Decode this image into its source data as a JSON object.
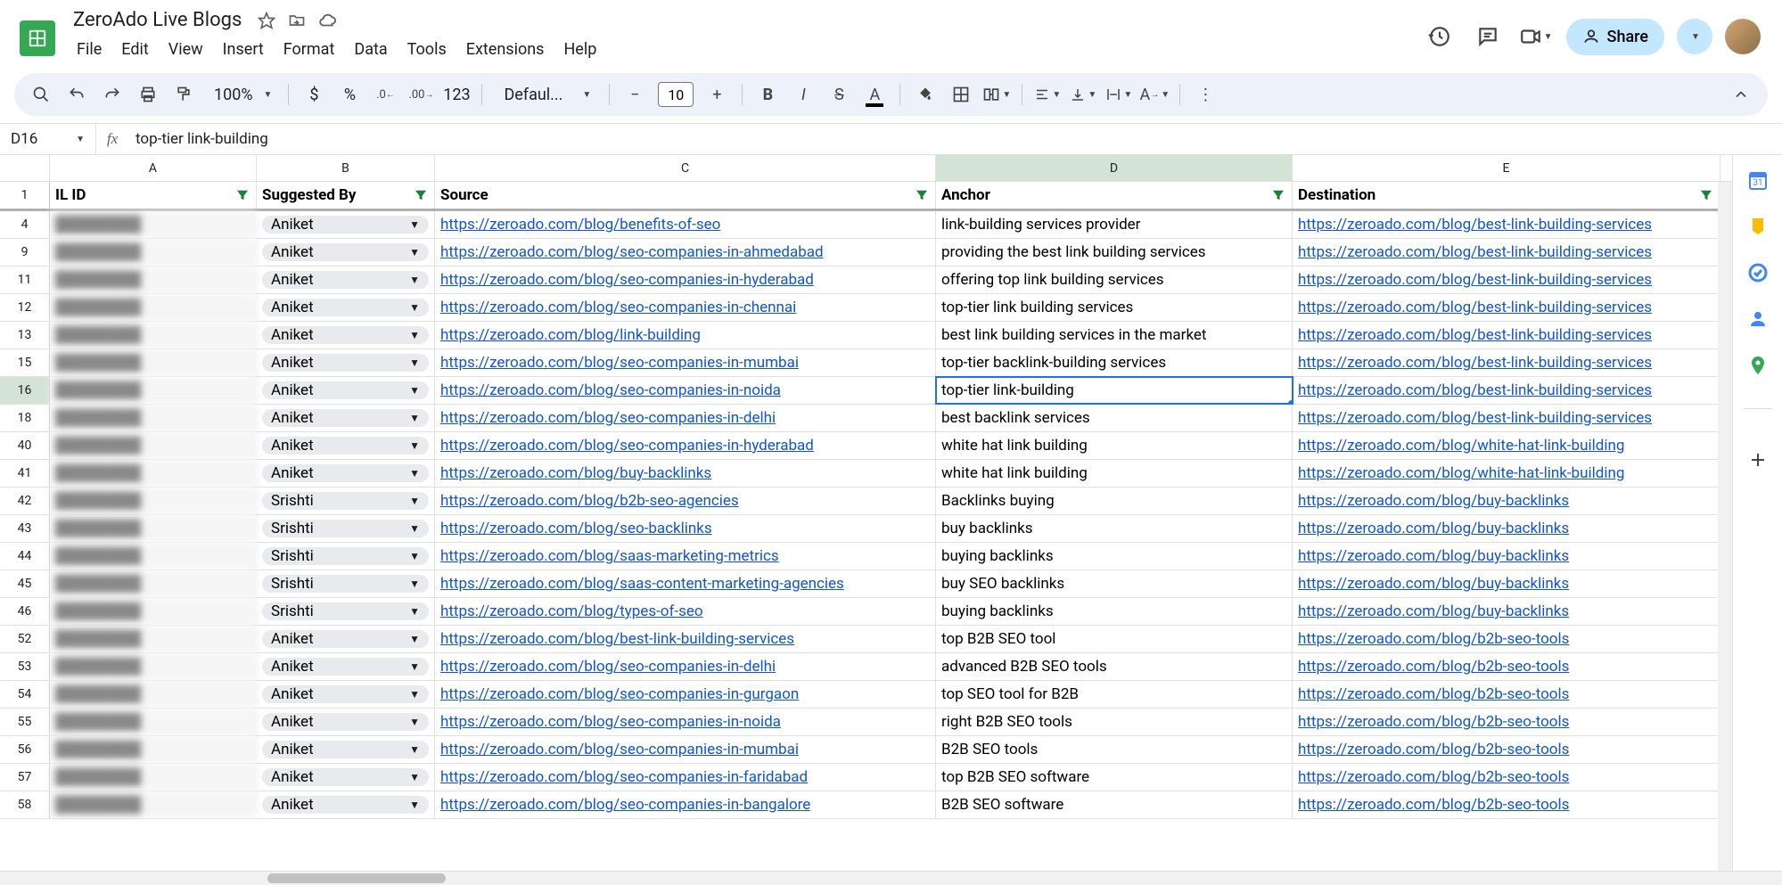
{
  "doc_title": "ZeroAdo Live Blogs",
  "menu": {
    "file": "File",
    "edit": "Edit",
    "view": "View",
    "insert": "Insert",
    "format": "Format",
    "data": "Data",
    "tools": "Tools",
    "extensions": "Extensions",
    "help": "Help"
  },
  "share_label": "Share",
  "toolbar": {
    "zoom": "100%",
    "font": "Defaul...",
    "size": "10",
    "currency": "$",
    "percent": "%",
    "dec_dec": ".0",
    "dec_inc": ".00",
    "num_fmt": "123"
  },
  "name_box": "D16",
  "formula": "top-tier link-building",
  "columns": [
    "A",
    "B",
    "C",
    "D",
    "E"
  ],
  "selected_col": "D",
  "selected_row": "16",
  "headers": {
    "A": "IL ID",
    "B": "Suggested By",
    "C": "Source",
    "D": "Anchor",
    "E": "Destination"
  },
  "row_numbers": [
    "1",
    "4",
    "9",
    "11",
    "12",
    "13",
    "15",
    "16",
    "18",
    "40",
    "41",
    "42",
    "43",
    "44",
    "45",
    "46",
    "52",
    "53",
    "54",
    "55",
    "56",
    "57",
    "58"
  ],
  "rows": [
    {
      "b": "Aniket",
      "c": "https://zeroado.com/blog/benefits-of-seo",
      "d": "link-building services provider",
      "e": "https://zeroado.com/blog/best-link-building-services"
    },
    {
      "b": "Aniket",
      "c": "https://zeroado.com/blog/seo-companies-in-ahmedabad",
      "d": "providing the best link building services",
      "e": "https://zeroado.com/blog/best-link-building-services"
    },
    {
      "b": "Aniket",
      "c": "https://zeroado.com/blog/seo-companies-in-hyderabad",
      "d": "offering top link building services",
      "e": "https://zeroado.com/blog/best-link-building-services"
    },
    {
      "b": "Aniket",
      "c": "https://zeroado.com/blog/seo-companies-in-chennai",
      "d": "top-tier link building services",
      "e": "https://zeroado.com/blog/best-link-building-services"
    },
    {
      "b": "Aniket",
      "c": "https://zeroado.com/blog/link-building",
      "d": "best link building services in the market",
      "e": "https://zeroado.com/blog/best-link-building-services"
    },
    {
      "b": "Aniket",
      "c": "https://zeroado.com/blog/seo-companies-in-mumbai",
      "d": "top-tier backlink-building services",
      "e": "https://zeroado.com/blog/best-link-building-services"
    },
    {
      "b": "Aniket",
      "c": "https://zeroado.com/blog/seo-companies-in-noida",
      "d": "top-tier link-building",
      "e": "https://zeroado.com/blog/best-link-building-services"
    },
    {
      "b": "Aniket",
      "c": "https://zeroado.com/blog/seo-companies-in-delhi",
      "d": "best backlink services",
      "e": "https://zeroado.com/blog/best-link-building-services"
    },
    {
      "b": "Aniket",
      "c": "https://zeroado.com/blog/seo-companies-in-hyderabad",
      "d": "white hat link building",
      "e": "https://zeroado.com/blog/white-hat-link-building"
    },
    {
      "b": "Aniket",
      "c": "https://zeroado.com/blog/buy-backlinks",
      "d": "white hat link building",
      "e": "https://zeroado.com/blog/white-hat-link-building"
    },
    {
      "b": "Srishti",
      "c": "https://zeroado.com/blog/b2b-seo-agencies",
      "d": "Backlinks buying",
      "e": "https://zeroado.com/blog/buy-backlinks"
    },
    {
      "b": "Srishti",
      "c": "https://zeroado.com/blog/seo-backlinks",
      "d": "buy backlinks",
      "e": "https://zeroado.com/blog/buy-backlinks"
    },
    {
      "b": "Srishti",
      "c": "https://zeroado.com/blog/saas-marketing-metrics",
      "d": "buying backlinks",
      "e": "https://zeroado.com/blog/buy-backlinks"
    },
    {
      "b": "Srishti",
      "c": "https://zeroado.com/blog/saas-content-marketing-agencies",
      "d": "buy SEO backlinks",
      "e": "https://zeroado.com/blog/buy-backlinks"
    },
    {
      "b": "Srishti",
      "c": "https://zeroado.com/blog/types-of-seo",
      "d": "buying backlinks",
      "e": "https://zeroado.com/blog/buy-backlinks"
    },
    {
      "b": "Aniket",
      "c": "https://zeroado.com/blog/best-link-building-services",
      "d": "top B2B SEO tool",
      "e": "https://zeroado.com/blog/b2b-seo-tools"
    },
    {
      "b": "Aniket",
      "c": "https://zeroado.com/blog/seo-companies-in-delhi",
      "d": "advanced B2B SEO tools",
      "e": "https://zeroado.com/blog/b2b-seo-tools"
    },
    {
      "b": "Aniket",
      "c": "https://zeroado.com/blog/seo-companies-in-gurgaon",
      "d": "top SEO tool for B2B",
      "e": "https://zeroado.com/blog/b2b-seo-tools"
    },
    {
      "b": "Aniket",
      "c": "https://zeroado.com/blog/seo-companies-in-noida",
      "d": "right B2B SEO tools",
      "e": "https://zeroado.com/blog/b2b-seo-tools"
    },
    {
      "b": "Aniket",
      "c": "https://zeroado.com/blog/seo-companies-in-mumbai",
      "d": "B2B SEO tools",
      "e": "https://zeroado.com/blog/b2b-seo-tools"
    },
    {
      "b": "Aniket",
      "c": "https://zeroado.com/blog/seo-companies-in-faridabad",
      "d": "top B2B SEO software",
      "e": "https://zeroado.com/blog/b2b-seo-tools"
    },
    {
      "b": "Aniket",
      "c": "https://zeroado.com/blog/seo-companies-in-bangalore",
      "d": "B2B SEO software",
      "e": "https://zeroado.com/blog/b2b-seo-tools"
    }
  ]
}
